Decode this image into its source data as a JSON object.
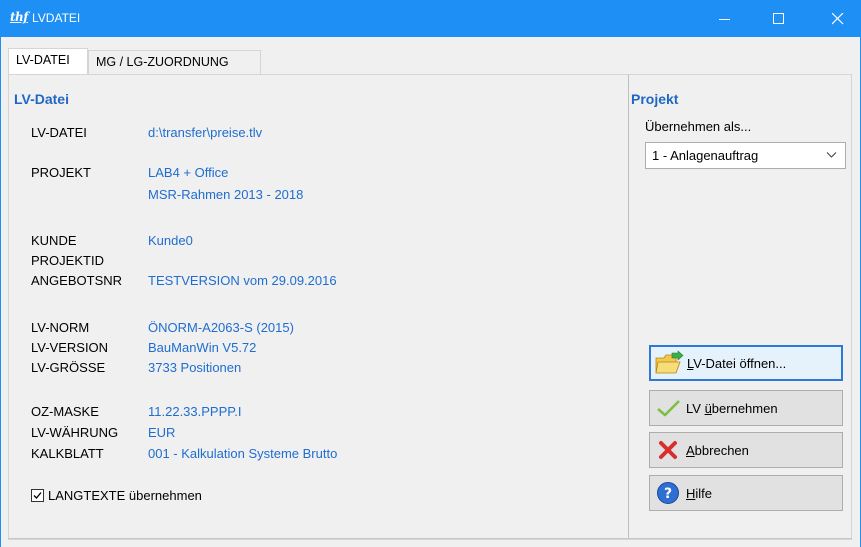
{
  "window": {
    "app_logo": "thf",
    "title": "LVDATEI"
  },
  "tabs": [
    {
      "label": "LV-DATEI"
    },
    {
      "label": "MG / LG-ZUORDNUNG"
    }
  ],
  "lv_section": {
    "title": "LV-Datei",
    "lv_datei_label": "LV-DATEI",
    "lv_datei_value": "d:\\transfer\\preise.tlv",
    "projekt_label": "PROJEKT",
    "projekt_value_1": "LAB4 + Office",
    "projekt_value_2": "MSR-Rahmen 2013 - 2018",
    "kunde_label": "KUNDE",
    "kunde_value": "Kunde0",
    "projektid_label": "PROJEKTID",
    "angebotsnr_label": "ANGEBOTSNR",
    "angebotsnr_value": "TESTVERSION vom 29.09.2016",
    "lv_norm_label": "LV-NORM",
    "lv_norm_value": "ÖNORM-A2063-S (2015)",
    "lv_version_label": "LV-VERSION",
    "lv_version_value": "BauManWin V5.72",
    "lv_groesse_label": "LV-GRÖSSE",
    "lv_groesse_value": "3733 Positionen",
    "oz_maske_label": "OZ-MASKE",
    "oz_maske_value": "11.22.33.PPPP.I",
    "lv_waehrung_label": "LV-WÄHRUNG",
    "lv_waehrung_value": "EUR",
    "kalkblatt_label": "KALKBLATT",
    "kalkblatt_value": "001 - Kalkulation Systeme Brutto",
    "langtexte_label": "LANGTEXTE übernehmen",
    "langtexte_checked": true
  },
  "projekt_section": {
    "title": "Projekt",
    "uebernehmen_label": "Übernehmen als...",
    "uebernehmen_selected": "1 - Anlagenauftrag"
  },
  "buttons": {
    "open": {
      "pre": "",
      "accel": "L",
      "post": "V-Datei öffnen..."
    },
    "apply": {
      "pre": "LV ",
      "accel": "ü",
      "post": "bernehmen"
    },
    "cancel": {
      "pre": "",
      "accel": "A",
      "post": "bbrechen"
    },
    "help": {
      "pre": "",
      "accel": "H",
      "post": "ilfe"
    }
  },
  "colors": {
    "titlebar": "#1e90f5",
    "section_title": "#1f67c4",
    "value_text": "#1f6dd0"
  }
}
